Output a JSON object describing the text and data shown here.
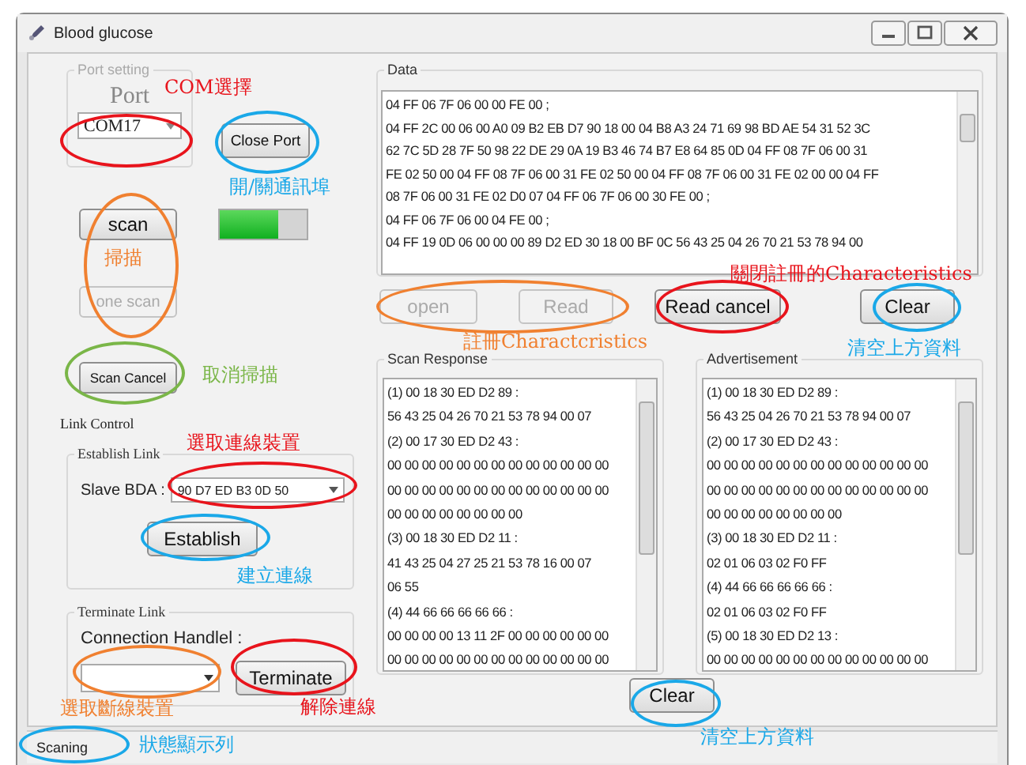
{
  "window": {
    "title": "Blood glucose"
  },
  "port_setting": {
    "title": "Port setting",
    "label": "Port",
    "value": "COM17",
    "button": "Close Port"
  },
  "scan_button": "scan",
  "connection_bar": {
    "level": 0.68
  },
  "one_scan_button": {
    "label": "one scan",
    "disabled": true
  },
  "scan_cancel_button": "Scan Cancel",
  "link_control": {
    "title": "Link Control",
    "establish": {
      "title": "Establish Link",
      "label": "Slave BDA :",
      "value": "90 D7 ED B3 0D 50",
      "button": "Establish"
    },
    "terminate": {
      "title": "Terminate Link",
      "label": "Connection Handlel :",
      "button": "Terminate"
    }
  },
  "data": {
    "title": "Data",
    "lines": [
      "04 FF 06 7F 06 00 00 FE 00 ;",
      "04 FF 2C 00 06 00 A0 09 B2 EB D7 90 18 00 04 B8 A3 24 71 69 98 BD AE 54 31 52 3C",
      "62 7C 5D 28 7F 50 98 22 DE 29 0A 19 B3 46 74 B7 E8 64 85 0D 04 FF 08 7F 06 00 31",
      "FE 02 50 00 04 FF 08 7F 06 00 31 FE 02 50 00 04 FF 08 7F 06 00 31 FE 02 00 00 04 FF",
      "08 7F 06 00 31 FE 02 D0 07 04 FF 06 7F 06 00 30 FE 00 ;",
      "04 FF 06 7F 06 00 04 FE 00 ;",
      "04 FF 19 0D 06 00 00 00 89 D2 ED 30 18 00 BF 0C 56 43 25 04 26 70 21 53 78 94 00"
    ]
  },
  "data_buttons": [
    {
      "label": "open",
      "disabled": true
    },
    {
      "label": "Read",
      "disabled": true
    },
    {
      "label": "Read cancel",
      "disabled": false
    },
    {
      "label": "Clear",
      "disabled": false
    }
  ],
  "scan_response": {
    "title": "Scan Response",
    "lines": [
      "(1)  00 18 30 ED D2 89  :",
      "56 43 25 04 26 70 21 53 78 94 00 07",
      "(2)  00 17 30 ED D2 43  :",
      "00 00 00 00 00 00 00 00 00 00 00 00 00",
      "00 00 00 00 00 00 00 00 00 00 00 00 00",
      "00 00 00 00 00 00 00 00",
      "(3)  00 18 30 ED D2 11  :",
      "41 43 25 04 27 25 21 53 78 16 00 07",
      "06 55",
      "(4)  44 66 66 66 66 66  :",
      "00 00 00 00 13 11 2F 00 00 00 00 00 00",
      "00 00 00 00 00 00 00 00 00 00 00 00 00"
    ]
  },
  "advertisement": {
    "title": "Advertisement",
    "lines": [
      "(1)  00 18 30 ED D2 89  :",
      "56 43 25 04 26 70 21 53 78 94 00 07",
      "(2)  00 17 30 ED D2 43  :",
      "00 00 00 00 00 00 00 00 00 00 00 00 00",
      "00 00 00 00 00 00 00 00 00 00 00 00 00",
      "00 00 00 00 00 00 00 00",
      "(3)  00 18 30 ED D2 11  :",
      "02 01 06 03 02 F0 FF",
      "(4)  44 66 66 66 66 66  :",
      "02 01 06 03 02 F0 FF",
      "(5)  00 18 30 ED D2 13  :",
      "00 00 00 00 00 00 00 00 00 00 00 00 00"
    ]
  },
  "clear_button": "Clear",
  "status_bar": "Scaning",
  "annotation_ellipses": [
    {
      "color": "#e8141c"
    },
    {
      "color": "#1aa8e8"
    },
    {
      "color": "#f08030"
    },
    {
      "color": "#7ab648"
    },
    {
      "color": "#e8141c"
    },
    {
      "color": "#1aa8e8"
    },
    {
      "color": "#f08030"
    },
    {
      "color": "#e8141c"
    },
    {
      "color": "#1aa8e8"
    },
    {
      "color": "#f08030"
    },
    {
      "color": "#e8141c"
    },
    {
      "color": "#1aa8e8"
    },
    {
      "color": "#1aa8e8"
    }
  ],
  "annotation_notes": [
    {
      "text": "COM選擇",
      "color": "#e8141c"
    },
    {
      "text": "開/關通訊埠",
      "color": "#1aa8e8"
    },
    {
      "text": "掃描",
      "color": "#f08030"
    },
    {
      "text": "取消掃描",
      "color": "#7ab648"
    },
    {
      "text": "選取連線裝置",
      "color": "#e8141c"
    },
    {
      "text": "建立連線",
      "color": "#1aa8e8"
    },
    {
      "text": "選取斷線裝置",
      "color": "#f08030"
    },
    {
      "text": "解除連線",
      "color": "#e8141c"
    },
    {
      "text": "狀態顯示列",
      "color": "#1aa8e8"
    },
    {
      "text": "註冊Charactcristics",
      "color": "#f08030"
    },
    {
      "text": "關閉註冊的Characteristics",
      "color": "#e8141c"
    },
    {
      "text": "清空上方資料",
      "color": "#1aa8e8"
    },
    {
      "text": "清空上方資料",
      "color": "#1aa8e8"
    }
  ]
}
